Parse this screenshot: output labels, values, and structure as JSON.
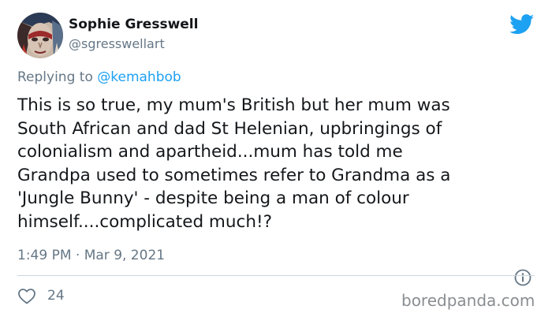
{
  "tweet": {
    "display_name": "Sophie Gresswell",
    "handle": "@sgresswellart",
    "replying_prefix": "Replying to ",
    "replying_to": "@kemahbob",
    "text": "This is so true, my mum's British but her mum was\nSouth African and dad St Helenian, upbringings of\ncolonialism and apartheid...mum has told me\nGrandpa used to sometimes refer to Grandma as a\n'Jungle Bunny' - despite being a man of colour\nhimself....complicated much!?",
    "timestamp": "1:49 PM · Mar 9, 2021",
    "like_count": "24"
  },
  "icons": {
    "brand": "twitter-bird-icon",
    "info": "info-icon",
    "like": "heart-icon"
  },
  "watermark": "boredpanda.com",
  "colors": {
    "twitter_blue": "#1da1f2",
    "primary_text": "#14171a",
    "secondary_text": "#657786",
    "link": "#1da1f2",
    "divider": "#ccd6dd"
  }
}
